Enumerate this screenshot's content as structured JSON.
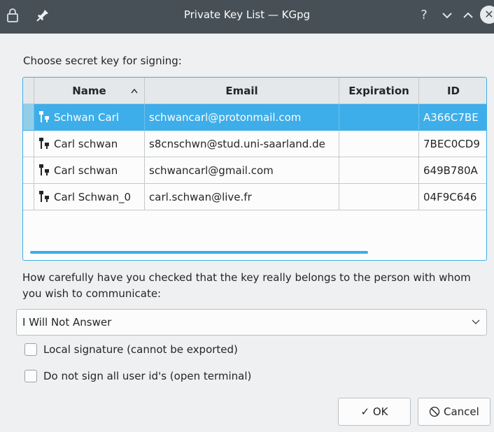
{
  "window": {
    "title": "Private Key List — KGpg",
    "help_glyph": "?",
    "minimize_glyph": "∨",
    "maximize_glyph": "∧",
    "close_glyph": "✕"
  },
  "prompt_label": "Choose secret key for signing:",
  "table": {
    "columns": [
      "Name",
      "Email",
      "Expiration",
      "ID"
    ],
    "sort_indicator": "^",
    "rows": [
      {
        "name": "Schwan Carl",
        "email": "schwancarl@protonmail.com",
        "expiration": "",
        "id": "A366C7BE",
        "selected": true
      },
      {
        "name": "Carl schwan",
        "email": "s8cnschwn@stud.uni-saarland.de",
        "expiration": "",
        "id": "7BEC0CD9",
        "selected": false
      },
      {
        "name": "Carl schwan",
        "email": "schwancarl@gmail.com",
        "expiration": "",
        "id": "649B780A",
        "selected": false
      },
      {
        "name": "Carl Schwan_0",
        "email": "carl.schwan@live.fr",
        "expiration": "",
        "id": "04F9C646",
        "selected": false
      }
    ]
  },
  "trust_question": {
    "line1": "How carefully have you checked that the key really belongs to the person with whom",
    "line2": "you wish to communicate:"
  },
  "trust_combo": {
    "value": "I Will Not Answer",
    "arrow": "⌵"
  },
  "checkboxes": [
    {
      "label": "Local signature (cannot be exported)",
      "checked": false
    },
    {
      "label": "Do not sign all user id's (open terminal)",
      "checked": false
    }
  ],
  "buttons": {
    "ok": "✓ OK",
    "cancel": "⃠ Cancel"
  },
  "colors": {
    "titlebar": "#475057",
    "accent": "#3daee9",
    "background": "#eff0f1"
  }
}
